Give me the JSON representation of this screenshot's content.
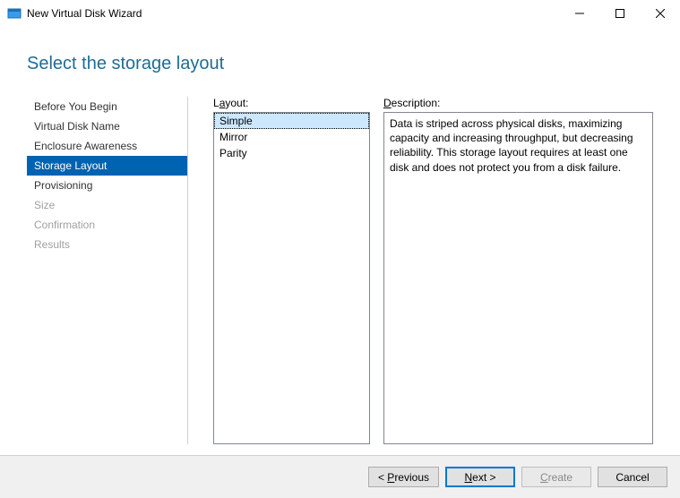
{
  "window": {
    "title": "New Virtual Disk Wizard"
  },
  "header": {
    "title": "Select the storage layout"
  },
  "nav": {
    "items": [
      {
        "label": "Before You Begin",
        "state": "normal"
      },
      {
        "label": "Virtual Disk Name",
        "state": "normal"
      },
      {
        "label": "Enclosure Awareness",
        "state": "normal"
      },
      {
        "label": "Storage Layout",
        "state": "active"
      },
      {
        "label": "Provisioning",
        "state": "normal"
      },
      {
        "label": "Size",
        "state": "disabled"
      },
      {
        "label": "Confirmation",
        "state": "disabled"
      },
      {
        "label": "Results",
        "state": "disabled"
      }
    ]
  },
  "layout": {
    "label_pre": "L",
    "label_ul": "a",
    "label_post": "yout:",
    "options": [
      {
        "label": "Simple",
        "selected": true
      },
      {
        "label": "Mirror",
        "selected": false
      },
      {
        "label": "Parity",
        "selected": false
      }
    ]
  },
  "description": {
    "label_pre": "",
    "label_ul": "D",
    "label_post": "escription:",
    "text": "Data is striped across physical disks, maximizing capacity and increasing throughput, but decreasing reliability. This storage layout requires at least one disk and does not protect you from a disk failure."
  },
  "buttons": {
    "previous_pre": "< ",
    "previous_ul": "P",
    "previous_post": "revious",
    "next_pre": "",
    "next_ul": "N",
    "next_post": "ext >",
    "create_pre": "",
    "create_ul": "C",
    "create_post": "reate",
    "cancel": "Cancel"
  }
}
